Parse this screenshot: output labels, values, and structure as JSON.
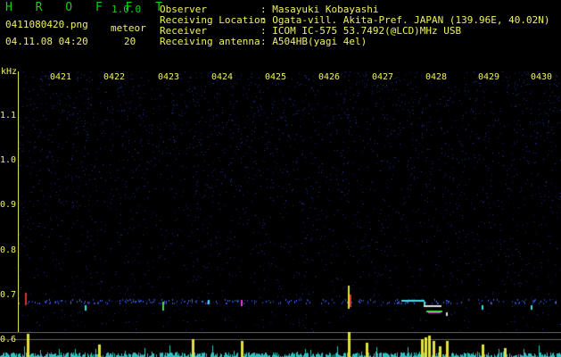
{
  "header": {
    "app_title": "H R O F F T",
    "version": "1.0.0",
    "file_name": "0411080420.png",
    "datetime": "04.11.08 04:20",
    "meteor_label": "meteor",
    "meteor_count": "20"
  },
  "info": [
    {
      "label": "Observer",
      "value": ": Masayuki Kobayashi"
    },
    {
      "label": "Receiving Location",
      "value": ": Ogata-vill. Akita-Pref. JAPAN (139.96E, 40.02N)"
    },
    {
      "label": "Receiver",
      "value": ": ICOM IC-575 53.7492(@LCD)MHz USB"
    },
    {
      "label": "Receiving antenna",
      "value": ": A504HB(yagi 4el)"
    }
  ],
  "plot": {
    "y_unit": "kHz",
    "y_ticks": [
      "1.1",
      "1.0",
      "0.9",
      "0.8",
      "0.7",
      "0.6"
    ],
    "x_ticks": [
      "0421",
      "0422",
      "0423",
      "0424",
      "0425",
      "0426",
      "0427",
      "0428",
      "0429",
      "0430"
    ]
  },
  "colors": {
    "background": "#000000",
    "noise": "#2030a0",
    "label_yellow": "#f0f060",
    "title_green": "#10d010",
    "echo_cyan": "#40e0e0"
  }
}
